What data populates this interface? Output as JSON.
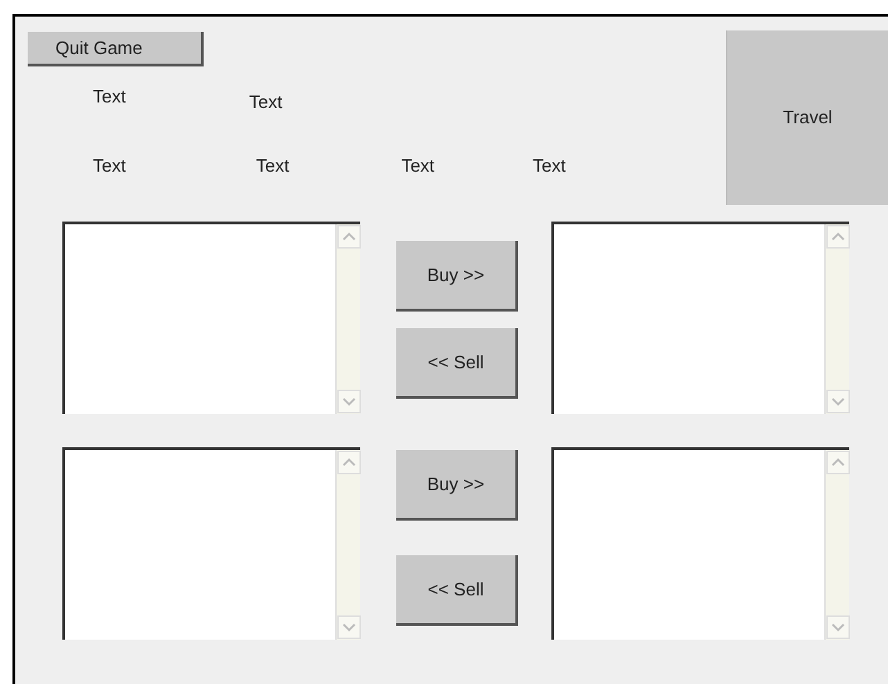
{
  "quit_button": {
    "label": "Quit Game"
  },
  "travel_button": {
    "label": "Travel"
  },
  "label_rows": [
    [
      "Text",
      "Text"
    ],
    [
      "Text",
      "Text",
      "Text",
      "Text"
    ]
  ],
  "trade_rows": [
    {
      "buy": "Buy >>",
      "sell": "<< Sell"
    },
    {
      "buy": "Buy >>",
      "sell": "<< Sell"
    }
  ]
}
